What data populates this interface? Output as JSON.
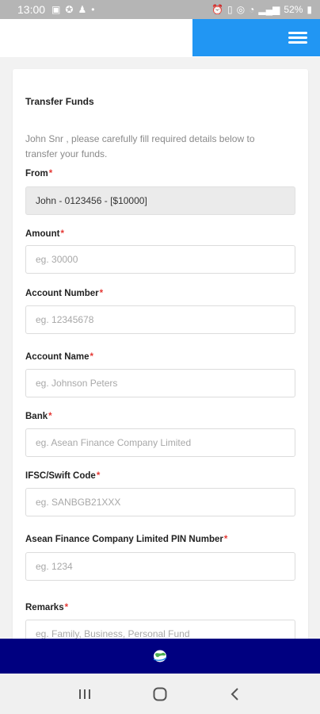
{
  "status_bar": {
    "time": "13:00",
    "battery": "52%",
    "left_icons": [
      "gallery-icon",
      "discord-icon",
      "snapchat-icon",
      "dot-icon"
    ],
    "right_icons": [
      "alarm-icon",
      "vibrate-icon",
      "hotspot-icon",
      "wifi-icon",
      "signal-icon",
      "battery-icon"
    ]
  },
  "header": {
    "accent_color": "#2196f3",
    "menu_icon": "hamburger-menu-icon"
  },
  "form": {
    "title": "Transfer Funds",
    "intro": "John Snr , please carefully fill required details below to transfer your funds.",
    "required_mark": "*",
    "from": {
      "label": "From",
      "value": "John - 0123456 - [$10000]"
    },
    "amount": {
      "label": "Amount",
      "placeholder": "eg. 30000"
    },
    "account_number": {
      "label": "Account Number",
      "placeholder": "eg. 12345678"
    },
    "account_name": {
      "label": "Account Name",
      "placeholder": "eg. Johnson Peters"
    },
    "bank": {
      "label": "Bank",
      "placeholder": "eg. Asean Finance Company Limited"
    },
    "swift": {
      "label": "IFSC/Swift Code",
      "placeholder": "eg. SANBGB21XXX"
    },
    "pin": {
      "label": "Asean Finance Company Limited PIN Number",
      "placeholder": "eg. 1234"
    },
    "remarks": {
      "label": "Remarks",
      "placeholder": "eg. Family, Business, Personal Fund"
    }
  },
  "bottom_bar": {
    "color": "#000080",
    "icon": "globe-icon"
  },
  "nav": {
    "icons": [
      "recent-apps-icon",
      "home-icon",
      "back-icon"
    ]
  }
}
